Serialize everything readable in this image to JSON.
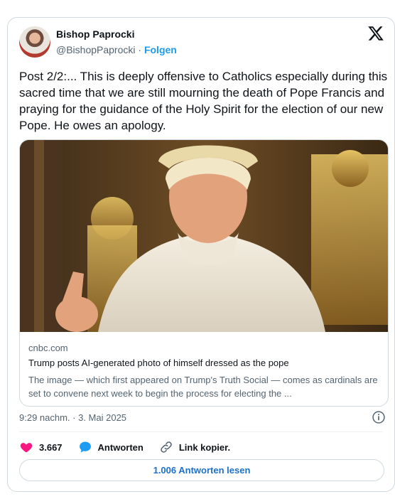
{
  "author": {
    "name": "Bishop Paprocki",
    "handle": "@BishopPaprocki",
    "separator": "·",
    "follow_label": "Folgen",
    "avatar_icon": "profile-avatar"
  },
  "platform_icon": "x-logo-icon",
  "tweet": {
    "text": "Post 2/2:... This is deeply offensive to Catholics especially during this sacred time that we are still mourning the death of Pope Francis and praying for the guidance of the Holy Spirit for the election of our new Pope. He owes an apology."
  },
  "link_card": {
    "domain": "cnbc.com",
    "title": "Trump posts AI-generated photo of himself dressed as the pope",
    "description": "The image — which first appeared on Trump's Truth Social — comes as cardinals are set to convene next week to begin the process for electing the ..."
  },
  "meta": {
    "timestamp": "9:29 nachm. · 3. Mai 2025",
    "info_icon": "info-icon"
  },
  "actions": {
    "likes": {
      "count": "3.667",
      "icon": "heart-icon",
      "color": "#f91880"
    },
    "reply": {
      "label": "Antworten",
      "icon": "speech-bubble-icon",
      "color": "#1d9bf0"
    },
    "copy_link": {
      "label": "Link kopier.",
      "icon": "link-icon"
    }
  },
  "read_replies_label": "1.006 Antworten lesen",
  "colors": {
    "accent": "#1d9bf0",
    "text": "#0f1419",
    "secondary": "#536471",
    "border": "#cfd9de"
  }
}
